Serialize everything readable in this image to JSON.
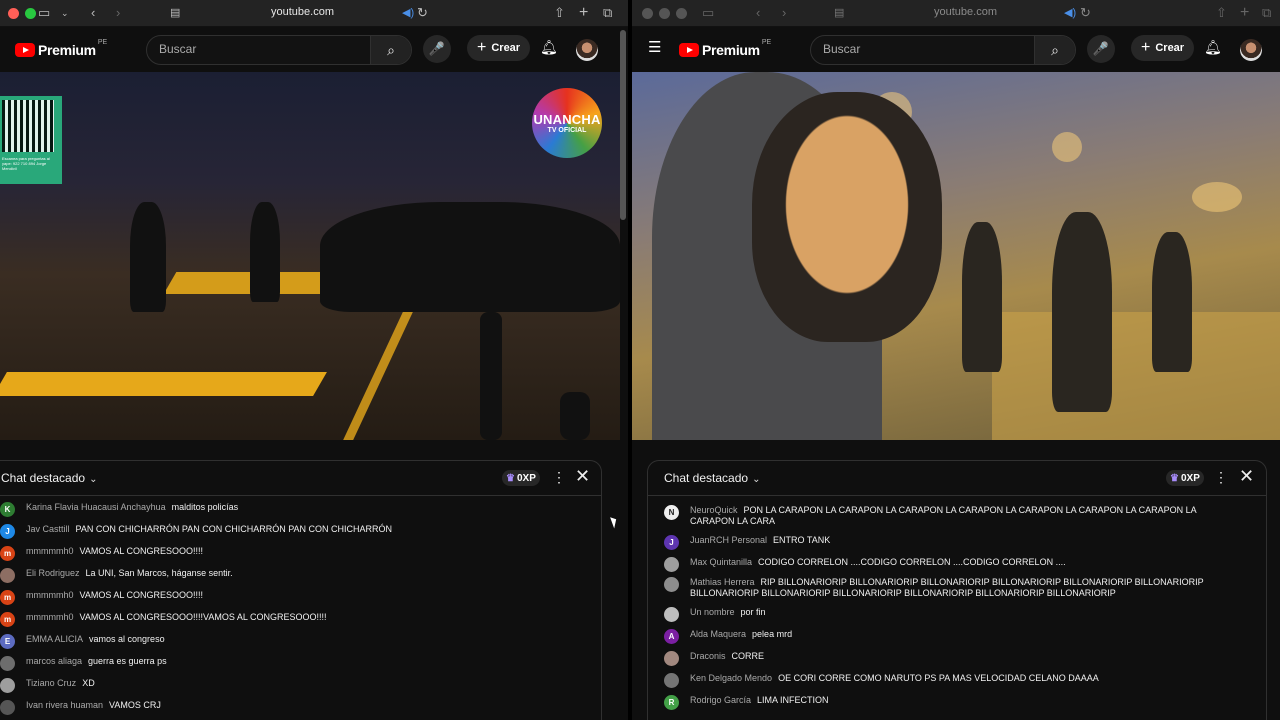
{
  "left": {
    "url": "youtube.com",
    "brand": "Premium",
    "region": "PE",
    "search_placeholder": "Buscar",
    "create_label": "Crear",
    "video": {
      "badge_line1": "UNANCHA",
      "badge_line2": "TV OFICIAL",
      "qr_caption": "Escanea para preguntas\nal yape: 922 710 894\nJorge Mendivil"
    },
    "chat": {
      "title": "Chat destacado",
      "xp": "0XP",
      "messages": [
        {
          "author": "Karina Flavia Huacausi Anchayhua",
          "text": "malditos policías",
          "initial": "K",
          "color": "#2e7d32"
        },
        {
          "author": "Jav Casttill",
          "text": "PAN CON CHICHARRÓN PAN CON CHICHARRÓN PAN CON CHICHARRÓN",
          "initial": "J",
          "color": "#1e88e5"
        },
        {
          "author": "mmmmmh0",
          "text": "VAMOS AL CONGRESOOO!!!!",
          "initial": "m",
          "color": "#d84315"
        },
        {
          "author": "Eli Rodriguez",
          "text": "La UNI, San Marcos, háganse sentir.",
          "initial": "",
          "color": "#8d6e63"
        },
        {
          "author": "mmmmmh0",
          "text": "VAMOS AL CONGRESOOO!!!!",
          "initial": "m",
          "color": "#d84315"
        },
        {
          "author": "mmmmmh0",
          "text": "VAMOS AL CONGRESOOO!!!!VAMOS AL CONGRESOOO!!!!",
          "initial": "m",
          "color": "#d84315"
        },
        {
          "author": "EMMA ALICIA",
          "text": "vamos al congreso",
          "initial": "E",
          "color": "#5c6bc0"
        },
        {
          "author": "marcos aliaga",
          "text": "guerra es guerra ps",
          "initial": "",
          "color": "#6d6d6d"
        },
        {
          "author": "Tiziano Cruz",
          "text": "XD",
          "initial": "",
          "color": "#9e9e9e"
        },
        {
          "author": "Ivan rivera huaman",
          "text": "VAMOS CRJ",
          "initial": "",
          "color": "#555555"
        }
      ]
    }
  },
  "right": {
    "url": "youtube.com",
    "brand": "Premium",
    "region": "PE",
    "search_placeholder": "Buscar",
    "create_label": "Crear",
    "chat": {
      "title": "Chat destacado",
      "xp": "0XP",
      "messages": [
        {
          "author": "NeuroQuick",
          "text": "PON LA CARAPON LA CARAPON LA CARAPON LA CARAPON LA CARAPON LA CARAPON LA CARAPON LA CARAPON LA CARA",
          "initial": "N",
          "color": "#eeeeee"
        },
        {
          "author": "JuanRCH Personal",
          "text": "ENTRO TANK",
          "initial": "J",
          "color": "#5e35b1"
        },
        {
          "author": "Max Quintanilla",
          "text": "CODIGO CORRELON ....CODIGO CORRELON ....CODIGO CORRELON ....",
          "initial": "",
          "color": "#9e9e9e"
        },
        {
          "author": "Mathias Herrera",
          "text": "RIP BILLONARIORIP BILLONARIORIP BILLONARIORIP BILLONARIORIP BILLONARIORIP BILLONARIORIP BILLONARIORIP BILLONARIORIP BILLONARIORIP BILLONARIORIP BILLONARIORIP BILLONARIORIP",
          "initial": "",
          "color": "#8d8d8d"
        },
        {
          "author": "Un nombre",
          "text": "por fin",
          "initial": "",
          "color": "#bdbdbd"
        },
        {
          "author": "Alda Maquera",
          "text": "pelea mrd",
          "initial": "A",
          "color": "#7b1fa2"
        },
        {
          "author": "Draconis",
          "text": "CORRE",
          "initial": "",
          "color": "#a1887f"
        },
        {
          "author": "Ken Delgado Mendo",
          "text": "OE CORI CORRE COMO NARUTO PS PA MAS VELOCIDAD CELANO DAAAA",
          "initial": "",
          "color": "#757575"
        },
        {
          "author": "Rodrigo García",
          "text": "LIMA INFECTION",
          "initial": "R",
          "color": "#43a047"
        }
      ]
    }
  }
}
